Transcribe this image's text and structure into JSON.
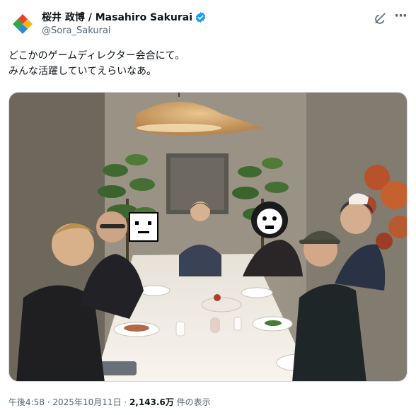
{
  "author": {
    "display_name": "桜井 政博 / Masahiro Sakurai",
    "handle": "@Sora_Sakurai",
    "verified": true,
    "avatar_icon": "colorful-plus-logo-icon"
  },
  "actions": {
    "grok_icon": "grok-icon",
    "more_icon": "more-options-icon"
  },
  "tweet": {
    "line1": "どこかのゲームディレクター会合にて。",
    "line2": "みんな活躍していてえらいなあ。"
  },
  "meta": {
    "time": "午後4:58",
    "sep1": " · ",
    "date": "2025年10月11日",
    "sep2": " · ",
    "views_count": "2,143.6万",
    "views_label": " 件の表示"
  },
  "colors": {
    "text": "#0f1419",
    "secondary": "#536471",
    "verified": "#1d9bf0"
  }
}
